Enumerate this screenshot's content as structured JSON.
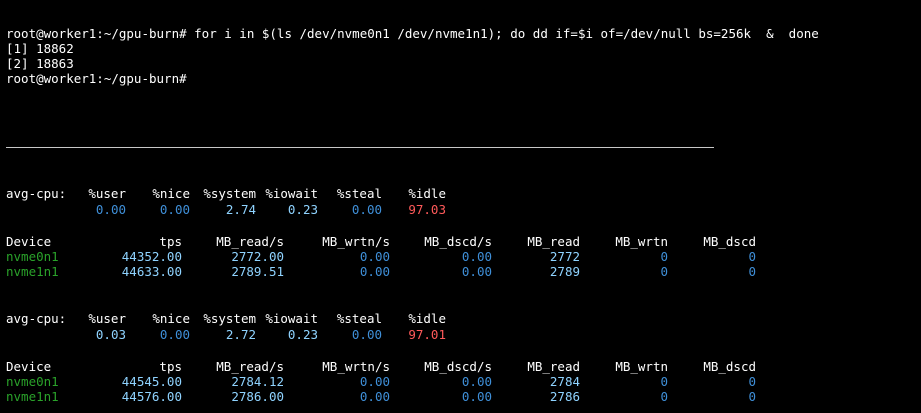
{
  "colors": {
    "background": "#000000",
    "text": "#ffffff",
    "value_dim": "#3f8fd8",
    "value_bright": "#8fd3ff",
    "device": "#2aa22a",
    "idle": "#ff5a5a"
  },
  "top": {
    "command_line": "root@worker1:~/gpu-burn# for i in $(ls /dev/nvme0n1 /dev/nvme1n1); do dd if=$i of=/dev/null bs=256k  &  done",
    "job1": "[1] 18862",
    "job2": "[2] 18863",
    "prompt": "root@worker1:~/gpu-burn#"
  },
  "cpu_headers": {
    "label": "avg-cpu:",
    "user": "%user",
    "nice": "%nice",
    "system": "%system",
    "iowait": "%iowait",
    "steal": "%steal",
    "idle": "%idle"
  },
  "dev_headers": {
    "device": "Device",
    "tps": "tps",
    "read_s": "MB_read/s",
    "wrtn_s": "MB_wrtn/s",
    "dscd_s": "MB_dscd/s",
    "read": "MB_read",
    "wrtn": "MB_wrtn",
    "dscd": "MB_dscd"
  },
  "reports": [
    {
      "cpu": {
        "user": "0.00",
        "nice": "0.00",
        "system": "2.74",
        "iowait": "0.23",
        "steal": "0.00",
        "idle": "97.03"
      },
      "devices": [
        {
          "name": "nvme0n1",
          "tps": "44352.00",
          "read_s": "2772.00",
          "wrtn_s": "0.00",
          "dscd_s": "0.00",
          "read": "2772",
          "wrtn": "0",
          "dscd": "0"
        },
        {
          "name": "nvme1n1",
          "tps": "44633.00",
          "read_s": "2789.51",
          "wrtn_s": "0.00",
          "dscd_s": "0.00",
          "read": "2789",
          "wrtn": "0",
          "dscd": "0"
        }
      ]
    },
    {
      "cpu": {
        "user": "0.03",
        "nice": "0.00",
        "system": "2.72",
        "iowait": "0.23",
        "steal": "0.00",
        "idle": "97.01"
      },
      "devices": [
        {
          "name": "nvme0n1",
          "tps": "44545.00",
          "read_s": "2784.12",
          "wrtn_s": "0.00",
          "dscd_s": "0.00",
          "read": "2784",
          "wrtn": "0",
          "dscd": "0"
        },
        {
          "name": "nvme1n1",
          "tps": "44576.00",
          "read_s": "2786.00",
          "wrtn_s": "0.00",
          "dscd_s": "0.00",
          "read": "2786",
          "wrtn": "0",
          "dscd": "0"
        }
      ]
    }
  ]
}
